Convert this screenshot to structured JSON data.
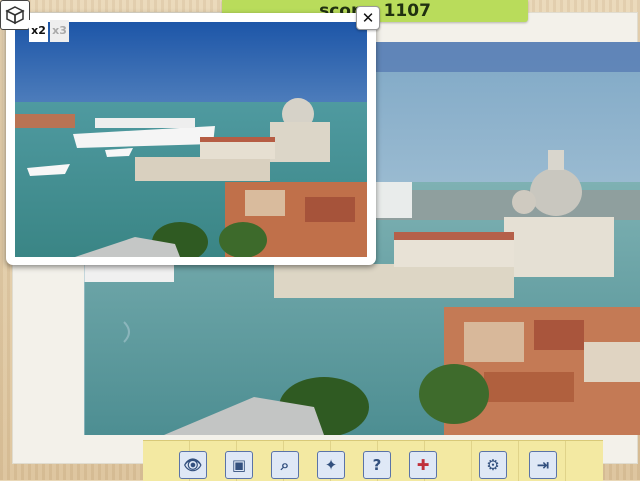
{
  "score": {
    "label": "score:",
    "value": "1107"
  },
  "preview": {
    "close_label": "✕",
    "multipliers": [
      {
        "label": "x2",
        "active": true
      },
      {
        "label": "x3",
        "active": false
      }
    ]
  },
  "toolbar": {
    "buttons": [
      {
        "name": "eye-icon",
        "glyph": "👁"
      },
      {
        "name": "picture-icon",
        "glyph": "▣"
      },
      {
        "name": "magnifier-icon",
        "glyph": "⌕"
      },
      {
        "name": "scatter-pieces-icon",
        "glyph": "✦"
      },
      {
        "name": "help-icon",
        "glyph": "?"
      },
      {
        "name": "puzzle-pieces-icon",
        "glyph": "✚"
      },
      {
        "name": "gear-icon",
        "glyph": "⚙"
      },
      {
        "name": "exit-door-icon",
        "glyph": "⇥"
      }
    ]
  },
  "colors": {
    "score_bar": "#b9dc5b",
    "sea": "#5a9aa0",
    "sky": "#9dbfd3",
    "roofs": "#b4573a"
  }
}
